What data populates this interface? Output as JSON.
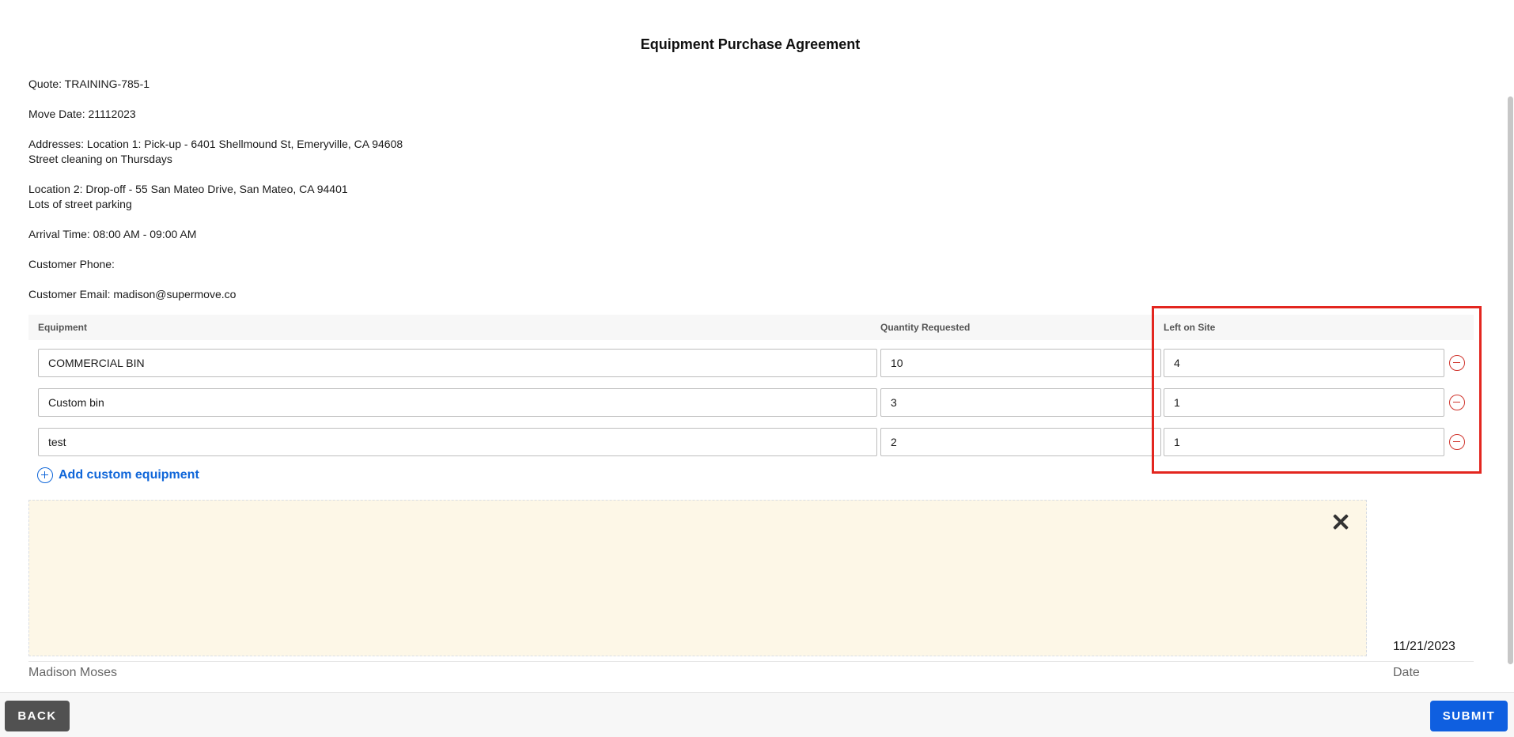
{
  "document": {
    "title": "Equipment Purchase Agreement",
    "quote_line": "Quote: TRAINING-785-1",
    "move_date_line": "Move Date: 21112023",
    "addresses_line": "Addresses: Location 1: Pick-up - 6401 Shellmound St, Emeryville, CA 94608",
    "location1_note": "Street cleaning on Thursdays",
    "location2_line": "Location 2: Drop-off - 55 San Mateo Drive, San Mateo, CA 94401",
    "location2_note": "Lots of street parking",
    "arrival_time_line": "Arrival Time: 08:00 AM - 09:00 AM",
    "customer_phone_line": "Customer Phone:",
    "customer_email_line": "Customer Email: madison@supermove.co"
  },
  "equipment_table": {
    "headers": {
      "equipment": "Equipment",
      "quantity_requested": "Quantity Requested",
      "left_on_site": "Left on Site"
    },
    "rows": [
      {
        "equipment": "COMMERCIAL BIN",
        "quantity_requested": "10",
        "left_on_site": "4"
      },
      {
        "equipment": "Custom bin",
        "quantity_requested": "3",
        "left_on_site": "1"
      },
      {
        "equipment": "test",
        "quantity_requested": "2",
        "left_on_site": "1"
      }
    ],
    "add_custom_label": "Add custom equipment"
  },
  "signature": {
    "signer_name": "Madison Moses",
    "date_value": "11/21/2023",
    "date_label": "Date"
  },
  "footer": {
    "back_label": "BACK",
    "submit_label": "SUBMIT"
  },
  "colors": {
    "primary_blue": "#0f5fe0",
    "link_blue": "#0f66d9",
    "remove_red": "#d0342c",
    "highlight_red": "#e3261f",
    "signature_bg": "#fdf7e7",
    "back_button_gray": "#515151"
  },
  "icons": {
    "remove": "minus-circle-icon",
    "add": "plus-circle-icon",
    "clear_signature": "close-icon"
  }
}
